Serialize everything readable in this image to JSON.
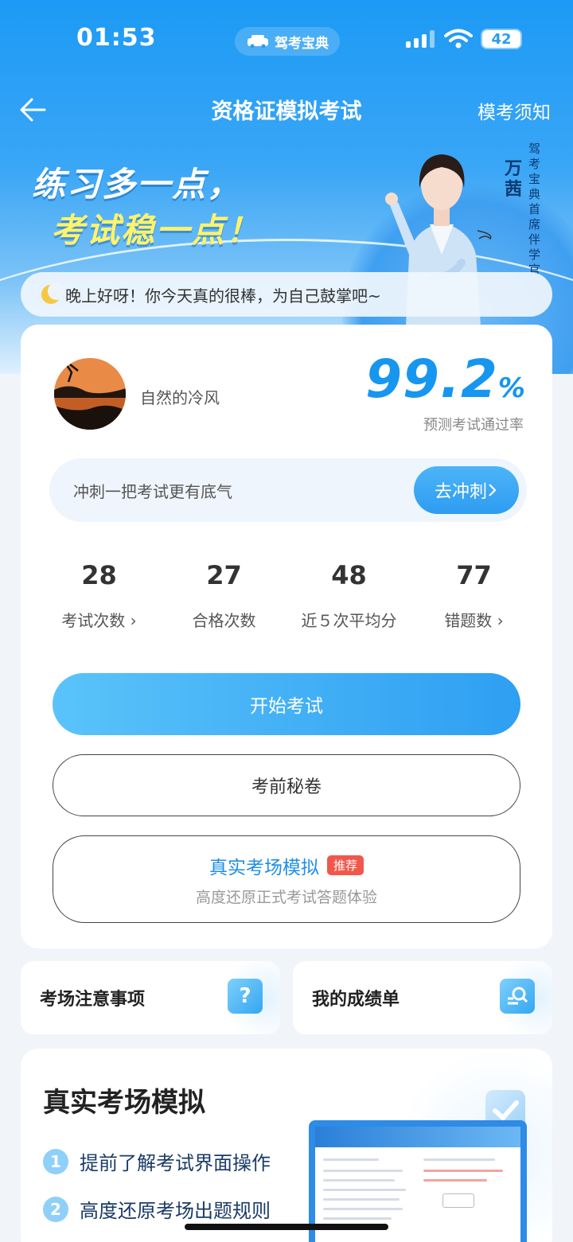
{
  "status_bar": {
    "time": "01:53",
    "app_name": "驾考宝典",
    "battery": "42"
  },
  "nav": {
    "title": "资格证模拟考试",
    "right_link": "模考须知"
  },
  "hero": {
    "slogan_line1": "练习多一点，",
    "slogan_line2": "考试稳一点！",
    "person_name": "万茜",
    "person_title": "驾考宝典首席伴学官"
  },
  "greeting": "晚上好呀！你今天真的很棒，为自己鼓掌吧~",
  "profile": {
    "username": "自然的冷风",
    "pass_rate": "99.2",
    "pass_rate_unit": "%",
    "pass_rate_label": "预测考试通过率"
  },
  "sprint": {
    "text": "冲刺一把考试更有底气",
    "button": "去冲刺"
  },
  "stats": [
    {
      "value": "28",
      "label": "考试次数"
    },
    {
      "value": "27",
      "label": "合格次数"
    },
    {
      "value": "48",
      "label": "近５次平均分"
    },
    {
      "value": "77",
      "label": "错题数"
    }
  ],
  "buttons": {
    "start": "开始考试",
    "secret": "考前秘卷",
    "real_title": "真实考场模拟",
    "real_badge": "推荐",
    "real_subtitle": "高度还原正式考试答题体验"
  },
  "mini_cards": [
    {
      "label": "考场注意事项",
      "icon": "question-icon"
    },
    {
      "label": "我的成绩单",
      "icon": "report-icon"
    }
  ],
  "simulation": {
    "title": "真实考场模拟",
    "features": [
      {
        "num": "1",
        "text": "提前了解考试界面操作"
      },
      {
        "num": "2",
        "text": "高度还原考场出题规则"
      }
    ]
  },
  "colors": {
    "primary": "#1c9af5",
    "accent_yellow": "#fff36b",
    "badge_red": "#f2574c"
  }
}
